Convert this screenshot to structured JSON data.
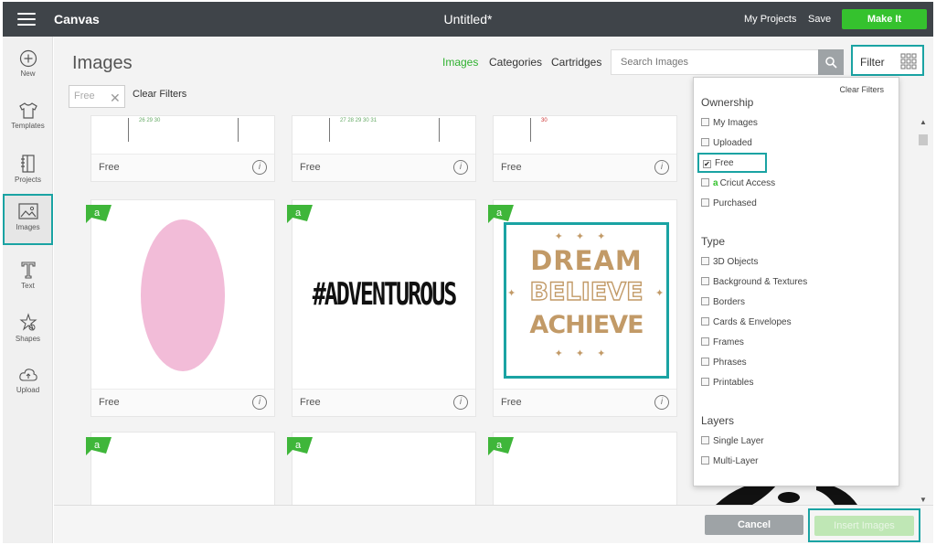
{
  "topbar": {
    "app_title": "Canvas",
    "doc_title": "Untitled*",
    "my_projects": "My Projects",
    "save": "Save",
    "make_it": "Make It"
  },
  "leftnav": {
    "items": [
      {
        "label": "New",
        "icon": "plus-circle-icon"
      },
      {
        "label": "Templates",
        "icon": "shirt-icon"
      },
      {
        "label": "Projects",
        "icon": "book-icon"
      },
      {
        "label": "Images",
        "icon": "image-icon",
        "selected": true
      },
      {
        "label": "Text",
        "icon": "text-t-icon"
      },
      {
        "label": "Shapes",
        "icon": "shapes-icon"
      },
      {
        "label": "Upload",
        "icon": "upload-cloud-icon"
      }
    ]
  },
  "header": {
    "page_title": "Images",
    "tabs": [
      {
        "label": "Images",
        "active": true
      },
      {
        "label": "Categories"
      },
      {
        "label": "Cartridges"
      }
    ],
    "search_placeholder": "Search Images",
    "filter_label": "Filter"
  },
  "active_filter": {
    "chip": "Free",
    "clear_filters": "Clear Filters"
  },
  "cards": {
    "row1": [
      {
        "price": "Free",
        "calendar": "26  29  30"
      },
      {
        "price": "Free",
        "calendar": "27  28  29  30  31"
      },
      {
        "price": "Free",
        "calendar": "30"
      }
    ],
    "row2": [
      {
        "price": "Free",
        "image": "pink-oval"
      },
      {
        "price": "Free",
        "image": "#ADVENTUROUS"
      },
      {
        "price": "Free",
        "image": "dream-believe-achieve",
        "lines": [
          "DREAM",
          "BELIEVE",
          "ACHIEVE"
        ]
      }
    ]
  },
  "filter_panel": {
    "clear_filters": "Clear Filters",
    "ownership": {
      "heading": "Ownership",
      "options": [
        {
          "label": "My Images",
          "checked": false
        },
        {
          "label": "Uploaded",
          "checked": false
        },
        {
          "label": "Free",
          "checked": true
        },
        {
          "label": "Cricut Access",
          "checked": false
        },
        {
          "label": "Purchased",
          "checked": false
        }
      ]
    },
    "type": {
      "heading": "Type",
      "options": [
        {
          "label": "3D Objects"
        },
        {
          "label": "Background & Textures"
        },
        {
          "label": "Borders"
        },
        {
          "label": "Cards & Envelopes"
        },
        {
          "label": "Frames"
        },
        {
          "label": "Phrases"
        },
        {
          "label": "Printables"
        }
      ]
    },
    "layers": {
      "heading": "Layers",
      "options": [
        {
          "label": "Single Layer"
        },
        {
          "label": "Multi-Layer"
        }
      ]
    }
  },
  "bottombar": {
    "cancel": "Cancel",
    "insert": "Insert Images"
  },
  "colors": {
    "topbar": "#3f4449",
    "accent_green": "#35c22e",
    "highlight_teal": "#1aa3a3",
    "access_badge": "#3fb63a",
    "dream_gold": "#c29a67",
    "oval_pink": "#f2bcd8"
  }
}
